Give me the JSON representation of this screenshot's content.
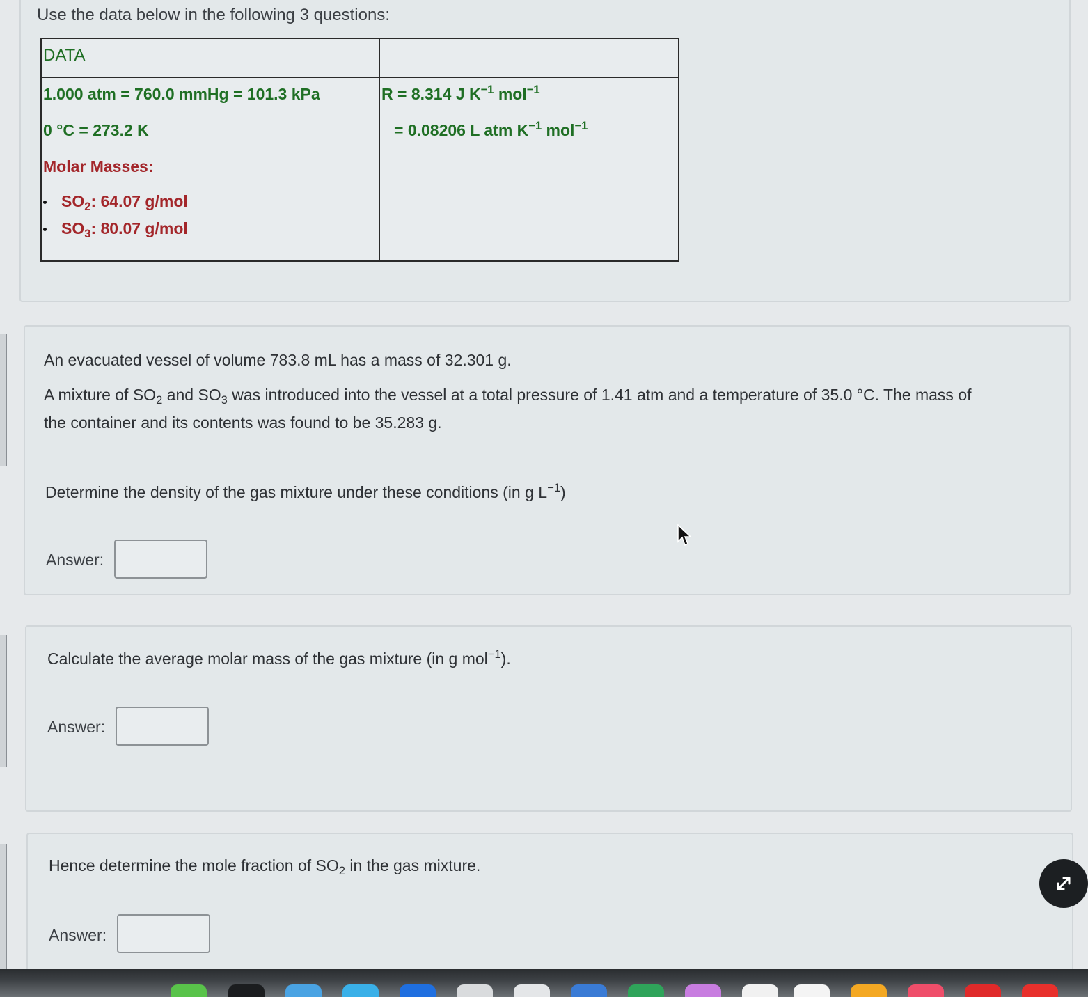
{
  "intro": "Use the data below in the following 3 questions:",
  "data_table": {
    "header": "DATA",
    "pressure": "1.000 atm = 760.0 mmHg = 101.3 kPa",
    "temperature": "0 °C = 273.2 K",
    "molar_masses_heading": "Molar Masses:",
    "so2": {
      "formula": "SO",
      "sub": "2",
      "value": ": 64.07 g/mol"
    },
    "so3": {
      "formula": "SO",
      "sub": "3",
      "value": ": 80.07 g/mol"
    },
    "r_line1": {
      "text": "R = 8.314  J K",
      "e1": "−1",
      "unit": " mol",
      "e2": "−1"
    },
    "r_line2": {
      "text": "= 0.08206 L atm K",
      "e1": "−1",
      "unit": " mol",
      "e2": "−1"
    }
  },
  "problem": {
    "line1": "An evacuated vessel of volume 783.8 mL has a mass of 32.301 g.",
    "line2a": "A mixture of SO",
    "line2a_sub": "2",
    "line2b": " and SO",
    "line2b_sub": "3",
    "line2c": " was introduced into the vessel at a total pressure of 1.41 atm and a temperature of 35.0 °C. The mass of",
    "line3": "the container and its contents was found to be 35.283 g.",
    "q1": "Determine the density of the gas mixture under these conditions (in g L",
    "q1_sup": "−1",
    "q1_end": ")"
  },
  "q2": {
    "text": "Calculate the average molar mass of the gas mixture (in g mol",
    "sup": "−1",
    "end": ")."
  },
  "q3": {
    "text": "Hence determine the mole fraction of SO",
    "sub": "2",
    "end": " in the gas mixture."
  },
  "answer_label": "Answer:",
  "answers": {
    "a1": "",
    "a2": "",
    "a3": ""
  },
  "icons": {
    "cursor": "arrow-cursor-icon",
    "fab": "expand-arrows-icon"
  }
}
